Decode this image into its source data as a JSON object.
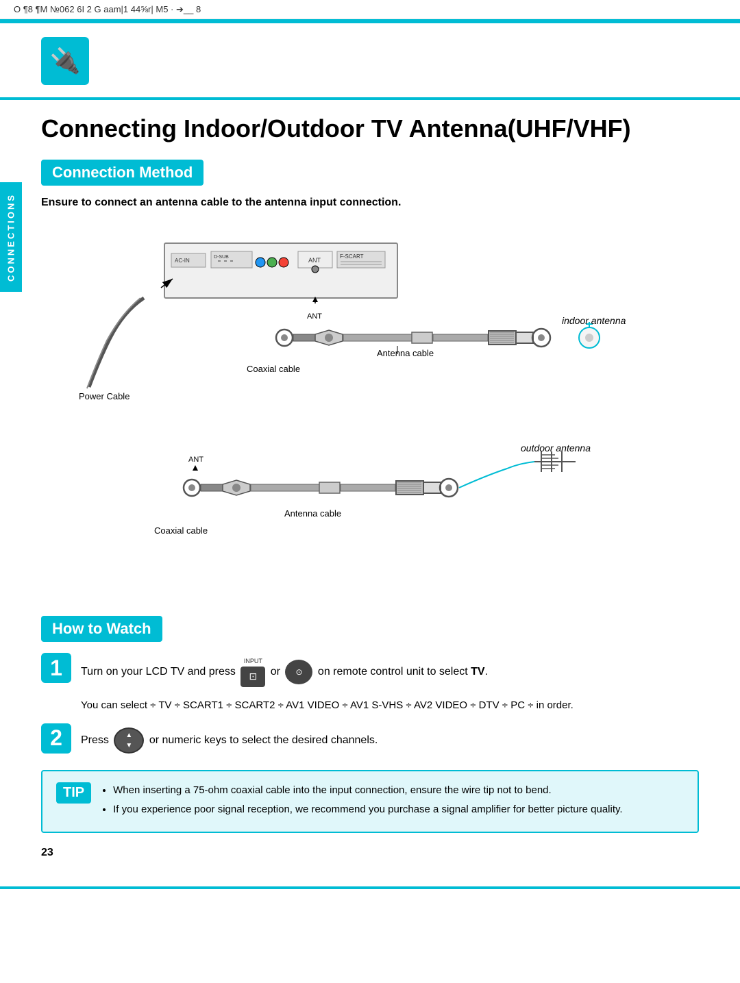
{
  "status_bar": {
    "text": "O ¶8 ¶M №062   6I 2 G  aam|1   44⅝r| M5 · ➔__ 8"
  },
  "logo": {
    "icon": "🔌"
  },
  "page": {
    "title": "Connecting Indoor/Outdoor TV Antenna(UHF/VHF)",
    "sidebar_label": "CONNECTIONS",
    "page_number": "23"
  },
  "connection_method": {
    "header": "Connection Method",
    "instruction": "Ensure to connect an antenna cable to the antenna input connection.",
    "labels": {
      "power_cable": "Power Cable",
      "antenna_cable_1": "Antenna cable",
      "coaxial_cable_1": "Coaxial cable",
      "indoor_antenna": "indoor antenna",
      "outdoor_antenna": "outdoor antenna",
      "antenna_cable_2": "Antenna cable",
      "coaxial_cable_2": "Coaxial cable",
      "ant": "ANT"
    }
  },
  "how_to_watch": {
    "header": "How to Watch",
    "step1": {
      "number": "1",
      "text_before": "Turn on your LCD TV and press",
      "text_or": "or",
      "text_after": "on remote control unit to select",
      "bold_word": "TV",
      "input_label": "INPUT"
    },
    "step1_selection": {
      "text": "You can select ÷ TV ÷ SCART1 ÷ SCART2 ÷ AV1 VIDEO ÷ AV1 S-VHS ÷ AV2 VIDEO ÷ DTV ÷ PC ÷  in order."
    },
    "step2": {
      "number": "2",
      "text_before": "Press",
      "text_after": "or numeric keys to select the desired channels."
    }
  },
  "tip": {
    "label": "TIP",
    "bullets": [
      "When inserting a 75-ohm coaxial cable into the input connection, ensure the wire tip not to bend.",
      "If you experience poor signal reception, we recommend you purchase a signal amplifier for better picture quality."
    ]
  }
}
